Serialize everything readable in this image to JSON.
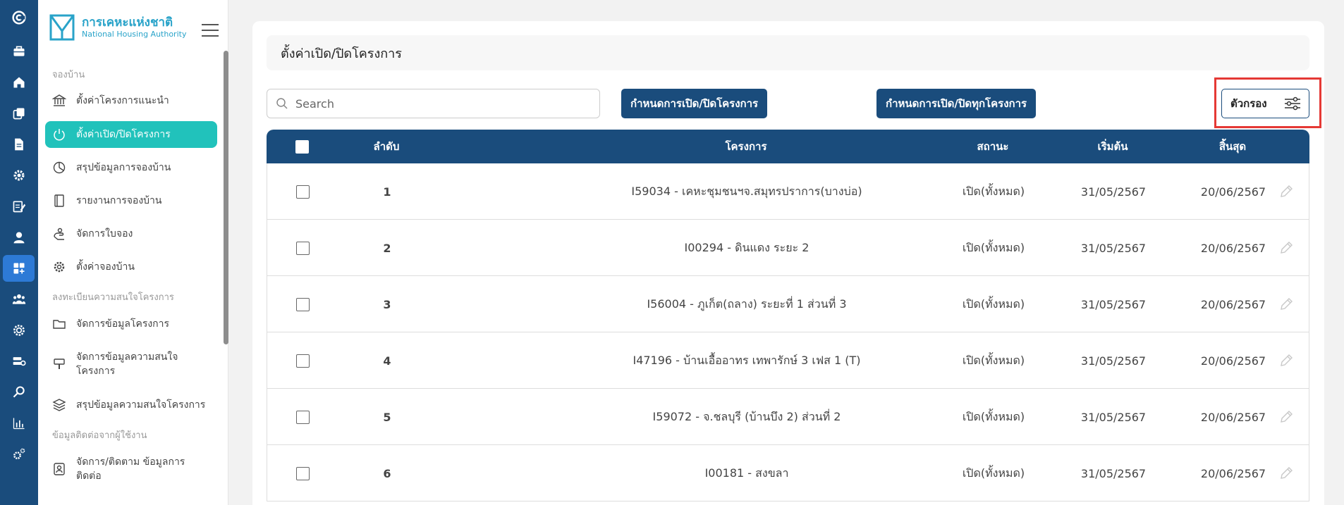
{
  "rail": {
    "icons": [
      "app-logo-icon",
      "briefcase-icon",
      "home-icon",
      "copy-icon",
      "document-icon",
      "settings-cog-icon",
      "edit-document-icon",
      "user-icon",
      "dashboard-add-icon",
      "group-icon",
      "settings-gear-icon",
      "server-settings-icon",
      "search-icon",
      "bar-chart-icon",
      "settings-multi-icon"
    ],
    "active_index": 8
  },
  "brand": {
    "name_th": "การเคหะแห่งชาติ",
    "name_en": "National Housing Authority"
  },
  "sidebar": {
    "section1": "จองบ้าน",
    "items1": [
      {
        "label": "ตั้งค่าโครงการแนะนำ",
        "icon": "bank-icon"
      },
      {
        "label": "ตั้งค่าเปิด/ปิดโครงการ",
        "icon": "power-icon"
      },
      {
        "label": "สรุปข้อมูลการจองบ้าน",
        "icon": "pie-chart-icon"
      },
      {
        "label": "รายงานการจองบ้าน",
        "icon": "book-icon"
      },
      {
        "label": "จัดการใบจอง",
        "icon": "hand-icon"
      },
      {
        "label": "ตั้งค่าจองบ้าน",
        "icon": "gear-icon"
      }
    ],
    "section2": "ลงทะเบียนความสนใจโครงการ",
    "items2": [
      {
        "label": "จัดการข้อมูลโครงการ",
        "icon": "folder-icon"
      },
      {
        "label_line1": "จัดการข้อมูลความสนใจ",
        "label_line2": "โครงการ",
        "icon": "brush-icon"
      },
      {
        "label": "สรุปข้อมูลความสนใจโครงการ",
        "icon": "layers-icon"
      }
    ],
    "section3": "ข้อมูลติดต่อจากผู้ใช้งาน",
    "items3": [
      {
        "label_line1": "จัดการ/ติดตาม ข้อมูลการ",
        "label_line2": "ติดต่อ",
        "icon": "contact-icon"
      }
    ]
  },
  "page": {
    "title": "ตั้งค่าเปิด/ปิดโครงการ"
  },
  "toolbar": {
    "search_placeholder": "Search",
    "btn_set_open_close": "กำหนดการเปิด/ปิดโครงการ",
    "btn_set_all": "กำหนดการเปิด/ปิดทุกโครงการ",
    "btn_filter": "ตัวกรอง"
  },
  "table": {
    "headers": {
      "num": "ลำดับ",
      "project": "โครงการ",
      "status": "สถานะ",
      "start": "เริ่มต้น",
      "end": "สิ้นสุด"
    },
    "rows": [
      {
        "num": "1",
        "project": "I59034 - เคหะชุมชนฯจ.สมุทรปราการ(บางบ่อ)",
        "status": "เปิด(ทั้งหมด)",
        "start": "31/05/2567",
        "end": "20/06/2567"
      },
      {
        "num": "2",
        "project": "I00294 - ดินแดง ระยะ 2",
        "status": "เปิด(ทั้งหมด)",
        "start": "31/05/2567",
        "end": "20/06/2567"
      },
      {
        "num": "3",
        "project": "I56004 - ภูเก็ต(ถลาง) ระยะที่ 1 ส่วนที่ 3",
        "status": "เปิด(ทั้งหมด)",
        "start": "31/05/2567",
        "end": "20/06/2567"
      },
      {
        "num": "4",
        "project": "I47196 - บ้านเอื้ออาทร เทพารักษ์ 3 เฟส 1 (T)",
        "status": "เปิด(ทั้งหมด)",
        "start": "31/05/2567",
        "end": "20/06/2567"
      },
      {
        "num": "5",
        "project": "I59072 - จ.ชลบุรี (บ้านบึง 2) ส่วนที่ 2",
        "status": "เปิด(ทั้งหมด)",
        "start": "31/05/2567",
        "end": "20/06/2567"
      },
      {
        "num": "6",
        "project": "I00181 - สงขลา",
        "status": "เปิด(ทั้งหมด)",
        "start": "31/05/2567",
        "end": "20/06/2567"
      }
    ]
  },
  "colors": {
    "rail": "#1a4c7c",
    "rail_active": "#2d7ad6",
    "menu_active": "#21c2bb",
    "primary": "#1a4c7c",
    "highlight": "#e53935"
  }
}
